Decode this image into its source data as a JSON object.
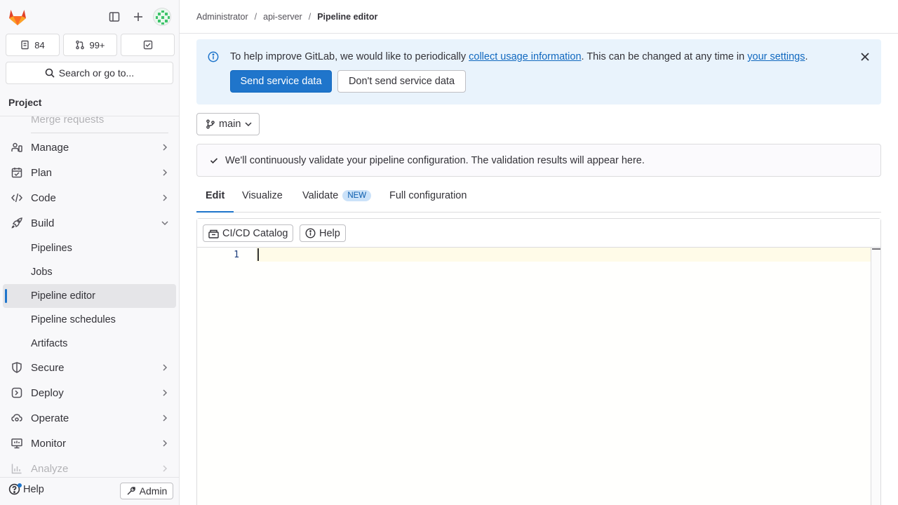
{
  "sidebar": {
    "counters": {
      "issues": "84",
      "merge_requests": "99+"
    },
    "search_label": "Search or go to...",
    "section_title": "Project",
    "nav": {
      "merge_requests": "Merge requests",
      "manage": "Manage",
      "plan": "Plan",
      "code": "Code",
      "build": "Build",
      "pipelines": "Pipelines",
      "jobs": "Jobs",
      "pipeline_editor": "Pipeline editor",
      "pipeline_schedules": "Pipeline schedules",
      "artifacts": "Artifacts",
      "secure": "Secure",
      "deploy": "Deploy",
      "operate": "Operate",
      "monitor": "Monitor",
      "analyze": "Analyze"
    },
    "help_label": "Help",
    "admin_label": "Admin"
  },
  "breadcrumb": {
    "items": [
      "Administrator",
      "api-server"
    ],
    "separator": "/",
    "current": "Pipeline editor"
  },
  "banner": {
    "text_prefix": "To help improve GitLab, we would like to periodically ",
    "link1": "collect usage information",
    "text_mid": ". This can be changed at any time in ",
    "link2": "your settings",
    "text_suffix": ".",
    "primary_button": "Send service data",
    "secondary_button": "Don't send service data"
  },
  "branch": {
    "name": "main"
  },
  "validation": {
    "message": "We'll continuously validate your pipeline configuration. The validation results will appear here."
  },
  "tabs": {
    "edit": "Edit",
    "visualize": "Visualize",
    "validate": "Validate",
    "validate_badge": "NEW",
    "full_config": "Full configuration"
  },
  "editor": {
    "toolbar": {
      "catalog": "CI/CD Catalog",
      "help": "Help"
    },
    "line_number": "1"
  },
  "colors": {
    "accent": "#1f75cb",
    "banner_bg": "#e9f3fc",
    "brand_orange": "#fc6d26"
  }
}
